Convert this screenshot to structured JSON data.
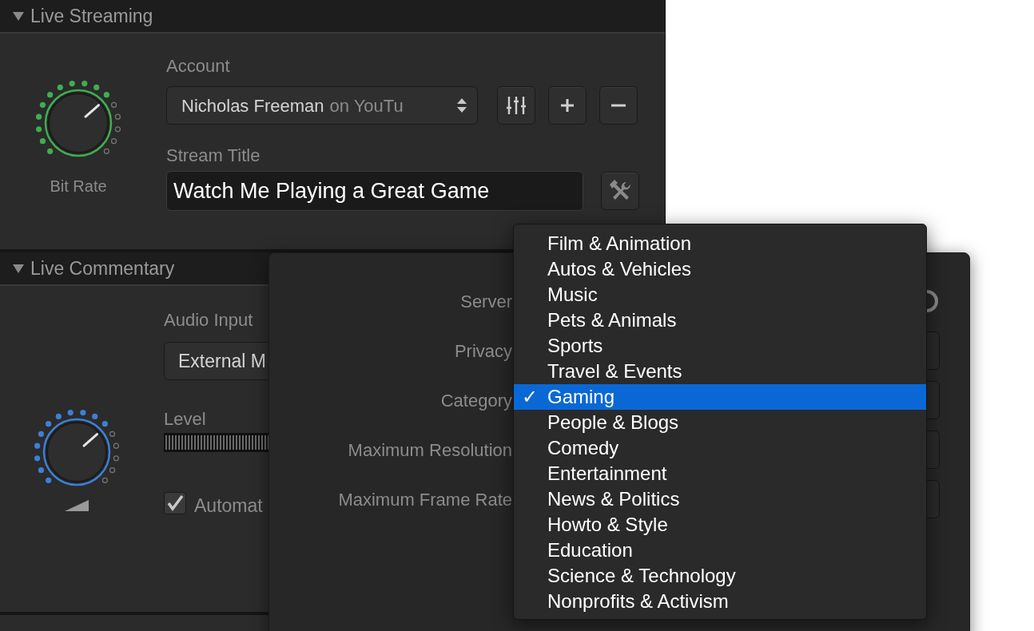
{
  "live_streaming": {
    "title": "Live Streaming",
    "expanded": true,
    "knob": {
      "label": "Bit Rate",
      "level": 0.68,
      "color": "#3fae4f"
    },
    "account_label": "Account",
    "account": {
      "name": "Nicholas Freeman",
      "service": "on YouTu"
    },
    "stream_title_label": "Stream Title",
    "stream_title": "Watch Me Playing a Great Game"
  },
  "live_commentary": {
    "title": "Live Commentary",
    "expanded": true,
    "knob": {
      "level": 0.68,
      "color": "#3d7fd6"
    },
    "audio_input_label": "Audio Input",
    "audio_input": "External M",
    "level_label": "Level",
    "auto_checkbox": {
      "label": "Automat",
      "checked": true
    }
  },
  "popover": {
    "rows": [
      {
        "label": "Server",
        "kind": "toggle"
      },
      {
        "label": "Privacy",
        "kind": "field"
      },
      {
        "label": "Category",
        "kind": "field"
      },
      {
        "label": "Maximum Resolution",
        "kind": "field"
      },
      {
        "label": "Maximum Frame Rate",
        "kind": "field"
      }
    ]
  },
  "category_menu": {
    "check": "✓",
    "items": [
      {
        "label": "Film & Animation",
        "selected": false
      },
      {
        "label": "Autos & Vehicles",
        "selected": false
      },
      {
        "label": "Music",
        "selected": false
      },
      {
        "label": "Pets & Animals",
        "selected": false
      },
      {
        "label": "Sports",
        "selected": false
      },
      {
        "label": "Travel & Events",
        "selected": false
      },
      {
        "label": "Gaming",
        "selected": true
      },
      {
        "label": "People & Blogs",
        "selected": false
      },
      {
        "label": "Comedy",
        "selected": false
      },
      {
        "label": "Entertainment",
        "selected": false
      },
      {
        "label": "News & Politics",
        "selected": false
      },
      {
        "label": "Howto & Style",
        "selected": false
      },
      {
        "label": "Education",
        "selected": false
      },
      {
        "label": "Science & Technology",
        "selected": false
      },
      {
        "label": "Nonprofits & Activism",
        "selected": false
      }
    ]
  }
}
